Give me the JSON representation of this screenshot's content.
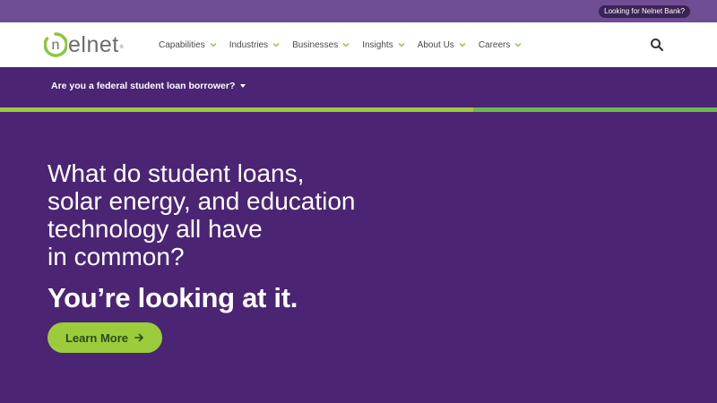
{
  "topbar": {
    "bank_link": "Looking for Nelnet Bank?"
  },
  "brand": {
    "logo_text": "nelnet",
    "logo_tm": "®"
  },
  "nav": {
    "items": [
      {
        "label": "Capabilities"
      },
      {
        "label": "Industries"
      },
      {
        "label": "Businesses"
      },
      {
        "label": "Insights"
      },
      {
        "label": "About Us"
      },
      {
        "label": "Careers"
      }
    ],
    "search_icon": "search-icon"
  },
  "subbar": {
    "borrower_prompt": "Are you a federal student loan borrower?"
  },
  "hero": {
    "headline_lines": [
      "What do student loans,",
      "solar energy, and education",
      "technology all have",
      "in common?"
    ],
    "tagline": "You’re looking at it.",
    "cta_label": "Learn More"
  },
  "colors": {
    "brand_purple": "#4b2474",
    "topbar_purple": "#6e4d94",
    "accent_green": "#9ccb3b",
    "accent_green_dark": "#6bbb4a"
  }
}
